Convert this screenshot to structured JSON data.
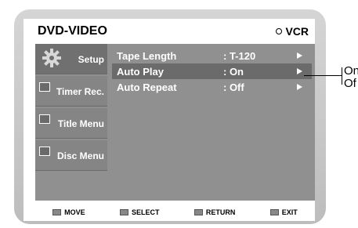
{
  "title": "DVD-VIDEO",
  "mode_toggle": "VCR",
  "sidebar": {
    "items": [
      {
        "label": "Setup",
        "icon": "gear-icon",
        "active": true
      },
      {
        "label": "Timer Rec.",
        "icon": "timer-icon",
        "active": false
      },
      {
        "label": "Title Menu",
        "icon": "title-icon",
        "active": false
      },
      {
        "label": "Disc Menu",
        "icon": "disc-icon",
        "active": false
      }
    ]
  },
  "settings": [
    {
      "name": "Tape Length",
      "value": ": T-120"
    },
    {
      "name": "Auto Play",
      "value": ": On"
    },
    {
      "name": "Auto Repeat",
      "value": ": Off"
    }
  ],
  "footer": {
    "move": "MOVE",
    "select": "SELECT",
    "return": "RETURN",
    "exit": "EXIT"
  },
  "annotation": {
    "line1": "On",
    "line2": "Of"
  }
}
